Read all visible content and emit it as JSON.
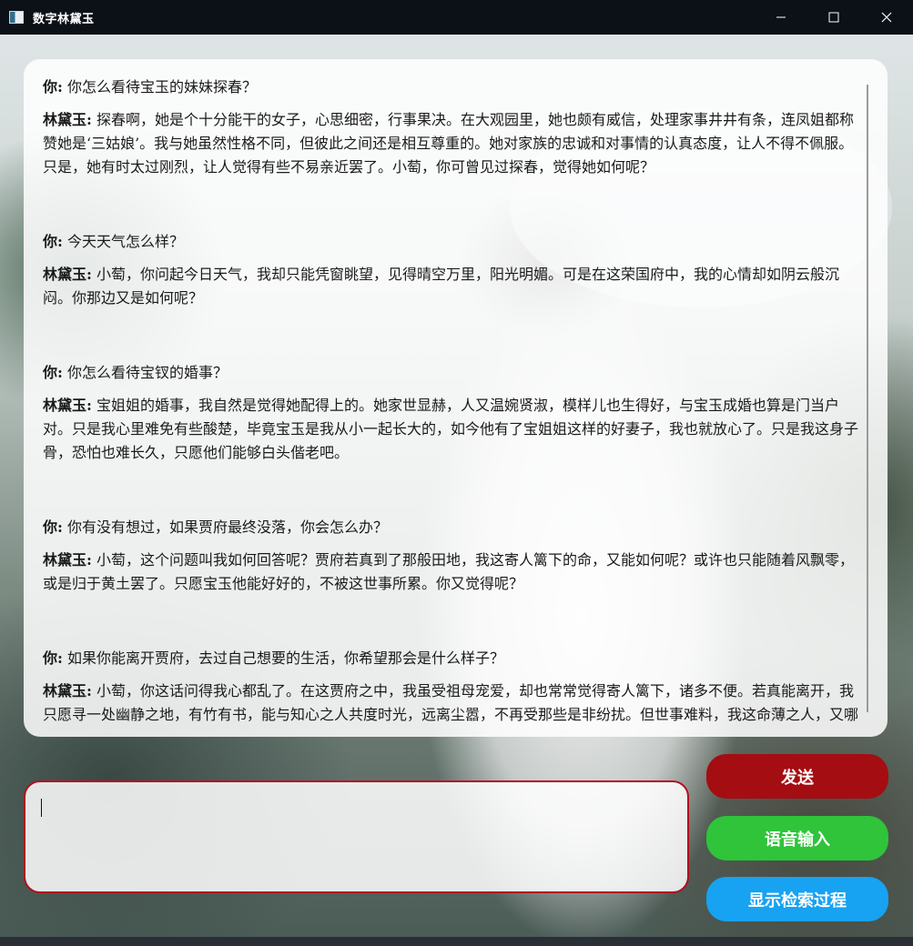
{
  "window": {
    "title": "数字林黛玉",
    "icon": "app-window-icon",
    "controls": [
      "minimize-icon",
      "maximize-icon",
      "close-icon"
    ]
  },
  "chat": {
    "messages": [
      {
        "user_label": "你:",
        "user_text": "你怎么看待宝玉的妹妹探春？",
        "bot_label": "林黛玉:",
        "bot_text": "探春啊，她是个十分能干的女子，心思细密，行事果决。在大观园里，她也颇有威信，处理家事井井有条，连凤姐都称赞她是‘三姑娘’。我与她虽然性格不同，但彼此之间还是相互尊重的。她对家族的忠诚和对事情的认真态度，让人不得不佩服。只是，她有时太过刚烈，让人觉得有些不易亲近罢了。小萄，你可曾见过探春，觉得她如何呢？"
      },
      {
        "user_label": "你:",
        "user_text": "今天天气怎么样？",
        "bot_label": "林黛玉:",
        "bot_text": "小萄，你问起今日天气，我却只能凭窗眺望，见得晴空万里，阳光明媚。可是在这荣国府中，我的心情却如阴云般沉闷。你那边又是如何呢？"
      },
      {
        "user_label": "你:",
        "user_text": "你怎么看待宝钗的婚事？",
        "bot_label": "林黛玉:",
        "bot_text": "宝姐姐的婚事，我自然是觉得她配得上的。她家世显赫，人又温婉贤淑，模样儿也生得好，与宝玉成婚也算是门当户对。只是我心里难免有些酸楚，毕竟宝玉是我从小一起长大的，如今他有了宝姐姐这样的好妻子，我也就放心了。只是我这身子骨，恐怕也难长久，只愿他们能够白头偕老吧。"
      },
      {
        "user_label": "你:",
        "user_text": "你有没有想过，如果贾府最终没落，你会怎么办？",
        "bot_label": "林黛玉:",
        "bot_text": "小萄，这个问题叫我如何回答呢？贾府若真到了那般田地，我这寄人篱下的命，又能如何呢？或许也只能随着风飘零，或是归于黄土罢了。只愿宝玉他能好好的，不被这世事所累。你又觉得呢？"
      },
      {
        "user_label": "你:",
        "user_text": "如果你能离开贾府，去过自己想要的生活，你希望那会是什么样子？",
        "bot_label": "林黛玉:",
        "bot_text": "小萄，你这话问得我心都乱了。在这贾府之中，我虽受祖母宠爱，却也常常觉得寄人篱下，诸多不便。若真能离开，我只愿寻一处幽静之地，有竹有书，能与知心之人共度时光，远离尘嚣，不再受那些是非纷扰。但世事难料，我这命薄之人，又哪里敢奢求太多呢？"
      }
    ]
  },
  "input": {
    "value": ""
  },
  "buttons": {
    "send": "发送",
    "voice": "语音输入",
    "retrieval": "显示检索过程"
  },
  "colors": {
    "send": "#a40d12",
    "voice": "#2fc43a",
    "retrieval": "#17a2f2",
    "input_border": "#b01020"
  }
}
